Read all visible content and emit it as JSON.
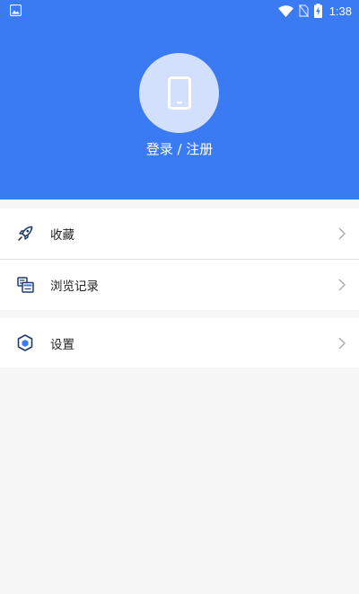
{
  "status_bar": {
    "time": "1:38",
    "icons": [
      "image-icon",
      "wifi-icon",
      "no-sim-icon",
      "battery-charging-icon"
    ]
  },
  "header": {
    "avatar_icon": "phone-icon",
    "login_label": "登录 / 注册",
    "background_color": "#3a7bf4",
    "avatar_bg_color": "#d3e0fd"
  },
  "menu": {
    "favorites": {
      "label": "收藏",
      "icon": "rocket-icon"
    },
    "history": {
      "label": "浏览记录",
      "icon": "history-icon"
    },
    "settings": {
      "label": "设置",
      "icon": "cube-settings-icon"
    }
  }
}
